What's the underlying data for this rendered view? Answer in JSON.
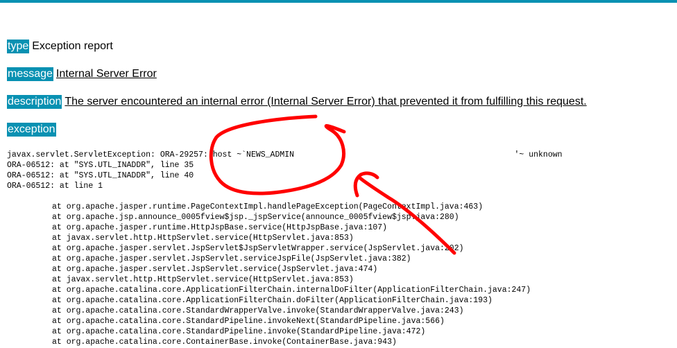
{
  "colors": {
    "accent": "#0891b2",
    "annotation": "#ff0000"
  },
  "report": {
    "type": {
      "label": "type",
      "value": "Exception report"
    },
    "message": {
      "label": "message",
      "value": "Internal Server Error"
    },
    "description": {
      "label": "description",
      "value": "The server encountered an internal error (Internal Server Error) that prevented it from fulfilling this request."
    },
    "exception": {
      "label": "exception"
    }
  },
  "exception_lines": [
    "javax.servlet.ServletException: ORA-29257: host ~`NEWS_ADMIN                                              '~ unknown",
    "ORA-06512: at \"SYS.UTL_INADDR\", line 35",
    "ORA-06512: at \"SYS.UTL_INADDR\", line 40",
    "ORA-06512: at line 1"
  ],
  "stack_trace": [
    "at org.apache.jasper.runtime.PageContextImpl.handlePageException(PageContextImpl.java:463)",
    "at org.apache.jsp.announce_0005fview$jsp._jspService(announce_0005fview$jsp.java:280)",
    "at org.apache.jasper.runtime.HttpJspBase.service(HttpJspBase.java:107)",
    "at javax.servlet.http.HttpServlet.service(HttpServlet.java:853)",
    "at org.apache.jasper.servlet.JspServlet$JspServletWrapper.service(JspServlet.java:202)",
    "at org.apache.jasper.servlet.JspServlet.serviceJspFile(JspServlet.java:382)",
    "at org.apache.jasper.servlet.JspServlet.service(JspServlet.java:474)",
    "at javax.servlet.http.HttpServlet.service(HttpServlet.java:853)",
    "at org.apache.catalina.core.ApplicationFilterChain.internalDoFilter(ApplicationFilterChain.java:247)",
    "at org.apache.catalina.core.ApplicationFilterChain.doFilter(ApplicationFilterChain.java:193)",
    "at org.apache.catalina.core.StandardWrapperValve.invoke(StandardWrapperValve.java:243)",
    "at org.apache.catalina.core.StandardPipeline.invokeNext(StandardPipeline.java:566)",
    "at org.apache.catalina.core.StandardPipeline.invoke(StandardPipeline.java:472)",
    "at org.apache.catalina.core.ContainerBase.invoke(ContainerBase.java:943)"
  ]
}
